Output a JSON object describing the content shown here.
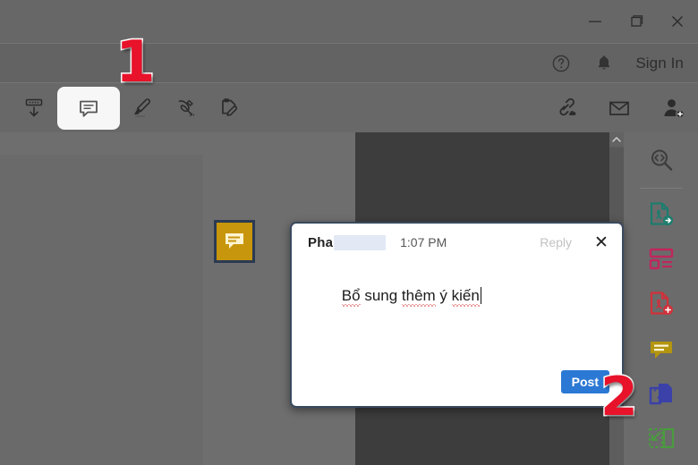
{
  "window": {
    "controls": [
      {
        "name": "minimize",
        "glyph": "minimize-icon"
      },
      {
        "name": "maximize",
        "glyph": "maximize-icon"
      },
      {
        "name": "close",
        "glyph": "close-icon"
      }
    ]
  },
  "menubar": {
    "help_icon": "help-circle-icon",
    "bell_icon": "bell-icon",
    "signin_label": "Sign In"
  },
  "toolbar": {
    "left_tools": [
      {
        "name": "download-tool",
        "icon": "download-icon",
        "active": false
      },
      {
        "name": "comment-tool",
        "icon": "comment-icon",
        "active": true
      },
      {
        "name": "highlight-tool",
        "icon": "highlighter-icon",
        "active": false
      },
      {
        "name": "sign-tool",
        "icon": "signature-pen-icon",
        "active": false
      },
      {
        "name": "fill-and-sign-tool",
        "icon": "fill-sign-icon",
        "active": false
      }
    ],
    "right_tools": [
      {
        "name": "share-link-tool",
        "icon": "link-cloud-icon"
      },
      {
        "name": "email-tool",
        "icon": "envelope-icon"
      },
      {
        "name": "add-person-tool",
        "icon": "person-add-icon"
      }
    ]
  },
  "right_rail": {
    "items": [
      {
        "name": "search-tool",
        "icon": "search-icon",
        "color": "#3c3c3c"
      },
      {
        "name": "export-pdf-tool",
        "icon": "pdf-export-icon",
        "color": "#1d7d6e"
      },
      {
        "name": "organize-pages-tool",
        "icon": "organize-pages-icon",
        "color": "#c0265c"
      },
      {
        "name": "create-pdf-tool",
        "icon": "pdf-create-icon",
        "color": "#d1313a"
      },
      {
        "name": "comment-tool",
        "icon": "comment-bubble-icon",
        "color": "#b3950f"
      },
      {
        "name": "compress-pdf-tool",
        "icon": "compress-pdf-icon",
        "color": "#3b41a8"
      },
      {
        "name": "crop-tool",
        "icon": "crop-page-icon",
        "color": "#4a9b3f"
      }
    ]
  },
  "document": {
    "marker": {
      "name": "comment-marker",
      "icon": "comment-icon",
      "fill": "#c8960c",
      "border": "#2a3a52"
    },
    "scrollbar": {
      "up_arrow": "chevron-up-icon"
    }
  },
  "popup": {
    "author": "Pha",
    "author_redacted": true,
    "time": "1:07 PM",
    "reply_label": "Reply",
    "close_label": "✕",
    "comment_text_parts": [
      {
        "text": "Bổ",
        "misspelled": true
      },
      {
        "text": " sung ",
        "misspelled": false
      },
      {
        "text": "thêm",
        "misspelled": true
      },
      {
        "text": " ý ",
        "misspelled": false
      },
      {
        "text": "kiến",
        "misspelled": true
      }
    ],
    "comment_text": "Bổ sung thêm ý kiến",
    "post_label": "Post",
    "post_color": "#2b79d4"
  },
  "annotations": [
    {
      "name": "step-1-badge",
      "label": "1",
      "color": "#e8122a"
    },
    {
      "name": "step-2-badge",
      "label": "2",
      "color": "#e8122a"
    }
  ]
}
